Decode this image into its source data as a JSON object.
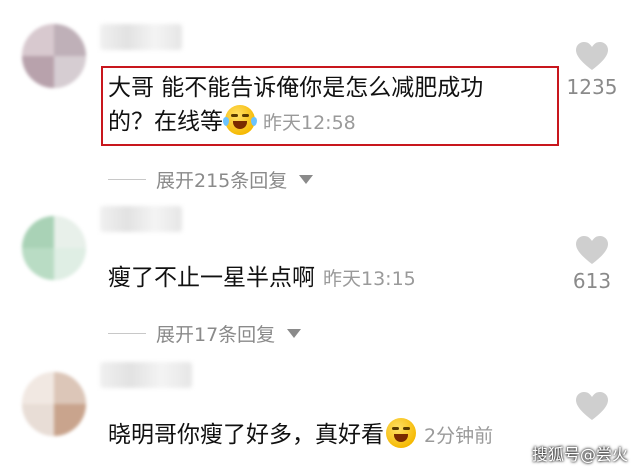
{
  "comments": [
    {
      "text_line1": "大哥 能不能告诉俺你是怎么减肥成功",
      "text_line2": "的？在线等",
      "emoji": "laughing-crying-emoji",
      "time": "昨天12:58",
      "likes": "1235",
      "replies_label": "展开215条回复"
    },
    {
      "text_line1": "瘦了不止一星半点啊",
      "time": "昨天13:15",
      "likes": "613",
      "replies_label": "展开17条回复"
    },
    {
      "text_line1": "晓明哥你瘦了好多，真好看",
      "emoji": "winking-emoji",
      "time": "2分钟前",
      "likes": ""
    }
  ],
  "colors": {
    "highlight_border": "#c8161d",
    "muted_text": "#8a8a8a",
    "heart": "#cfcfcf"
  },
  "watermark": "搜狐号@尝火"
}
